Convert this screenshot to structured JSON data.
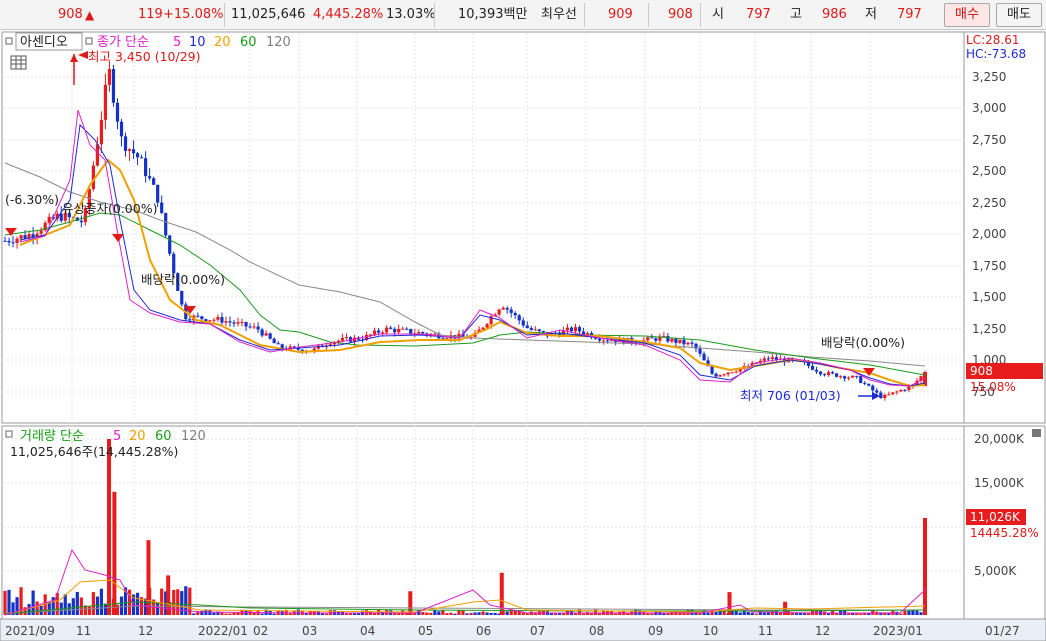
{
  "quote": {
    "price": "908",
    "arrow": "▲",
    "change": "119",
    "change_pct": "+15.08%",
    "volume": "11,025,646",
    "volume_ratio": "4,445.28%",
    "turnover": "13.03%",
    "amount": "10,393백만",
    "best_ask_label": "최우선",
    "best_ask": "909",
    "best_bid": "908",
    "open_label": "시",
    "open": "797",
    "high_label": "고",
    "high": "986",
    "low_label": "저",
    "low": "797"
  },
  "buttons": {
    "buy": "매수",
    "sell": "매도"
  },
  "price_panel": {
    "stock_name": "아센디오",
    "legend_title": "종가 단순",
    "ma_periods": [
      "5",
      "10",
      "20",
      "60",
      "120"
    ],
    "lc": "LC:28.61",
    "hc": "HC:-73.68",
    "y_ticks": [
      "3,250",
      "3,000",
      "2,750",
      "2,500",
      "2,250",
      "2,000",
      "1,750",
      "1,500",
      "1,250",
      "1,000",
      "750"
    ],
    "current_price_tag": "908",
    "current_pct_tag": "15.08%",
    "high_note": "최고 3,450 (10/29)",
    "low_note": "최저 706 (01/03)",
    "event_notes": [
      "(-6.30%)",
      "유상증자(0.00%)",
      "배당락(0.00%)",
      "배당락(0.00%)"
    ]
  },
  "volume_panel": {
    "legend_title": "거래량 단순",
    "ma_periods": [
      "5",
      "20",
      "60",
      "120"
    ],
    "current_volume": "11,025,646주(14,445.28%)",
    "y_ticks": [
      "20,000K",
      "15,000K",
      "5,000K"
    ],
    "current_vol_tag": "11,026K",
    "current_ratio_tag": "14445.28%"
  },
  "x_axis": [
    "2021/09",
    "11",
    "12",
    "2022/01",
    "02",
    "03",
    "04",
    "05",
    "06",
    "07",
    "08",
    "09",
    "10",
    "11",
    "12",
    "2023/01",
    "01/27"
  ],
  "colors": {
    "up": "#e81c1c",
    "down": "#1432c8",
    "ma5": "#e020c8",
    "ma10": "#1c2ad4",
    "ma20": "#f0a000",
    "ma60": "#16a016",
    "ma120": "#808080"
  },
  "chart_data": {
    "type": "candlestick",
    "x_range": [
      "2021-09",
      "2023-01-27"
    ],
    "ylim": [
      650,
      3450
    ],
    "price_series": [
      {
        "date": "2021-09-01",
        "close": 1950
      },
      {
        "date": "2021-09-15",
        "close": 2000
      },
      {
        "date": "2021-10-01",
        "close": 2150
      },
      {
        "date": "2021-10-15",
        "close": 2100
      },
      {
        "date": "2021-10-29",
        "close": 3300
      },
      {
        "date": "2021-11-05",
        "close": 2750
      },
      {
        "date": "2021-11-15",
        "close": 2600
      },
      {
        "date": "2021-11-25",
        "close": 2300
      },
      {
        "date": "2021-12-01",
        "close": 1900
      },
      {
        "date": "2021-12-10",
        "close": 1350
      },
      {
        "date": "2021-12-31",
        "close": 1320
      },
      {
        "date": "2022-01-20",
        "close": 1250
      },
      {
        "date": "2022-02-01",
        "close": 1100
      },
      {
        "date": "2022-02-20",
        "close": 1080
      },
      {
        "date": "2022-03-01",
        "close": 1150
      },
      {
        "date": "2022-03-20",
        "close": 1180
      },
      {
        "date": "2022-04-01",
        "close": 1250
      },
      {
        "date": "2022-04-20",
        "close": 1220
      },
      {
        "date": "2022-05-01",
        "close": 1200
      },
      {
        "date": "2022-05-20",
        "close": 1180
      },
      {
        "date": "2022-06-05",
        "close": 1450
      },
      {
        "date": "2022-06-20",
        "close": 1250
      },
      {
        "date": "2022-07-01",
        "close": 1200
      },
      {
        "date": "2022-07-15",
        "close": 1250
      },
      {
        "date": "2022-08-01",
        "close": 1170
      },
      {
        "date": "2022-08-20",
        "close": 1150
      },
      {
        "date": "2022-09-01",
        "close": 1180
      },
      {
        "date": "2022-09-20",
        "close": 1120
      },
      {
        "date": "2022-10-01",
        "close": 880
      },
      {
        "date": "2022-10-20",
        "close": 950
      },
      {
        "date": "2022-11-01",
        "close": 1020
      },
      {
        "date": "2022-11-20",
        "close": 980
      },
      {
        "date": "2022-12-01",
        "close": 900
      },
      {
        "date": "2022-12-20",
        "close": 860
      },
      {
        "date": "2023-01-03",
        "close": 706
      },
      {
        "date": "2023-01-20",
        "close": 800
      },
      {
        "date": "2023-01-27",
        "close": 908
      }
    ],
    "volume_series_k": [
      {
        "date": "2021-10-29",
        "value": 20000
      },
      {
        "date": "2021-11-01",
        "value": 14000
      },
      {
        "date": "2021-11-20",
        "value": 8500
      },
      {
        "date": "2021-12-01",
        "value": 4500
      },
      {
        "date": "2022-04-15",
        "value": 2700
      },
      {
        "date": "2022-06-05",
        "value": 4800
      },
      {
        "date": "2022-10-10",
        "value": 2600
      },
      {
        "date": "2022-11-10",
        "value": 1500
      },
      {
        "date": "2023-01-27",
        "value": 11026
      }
    ]
  }
}
